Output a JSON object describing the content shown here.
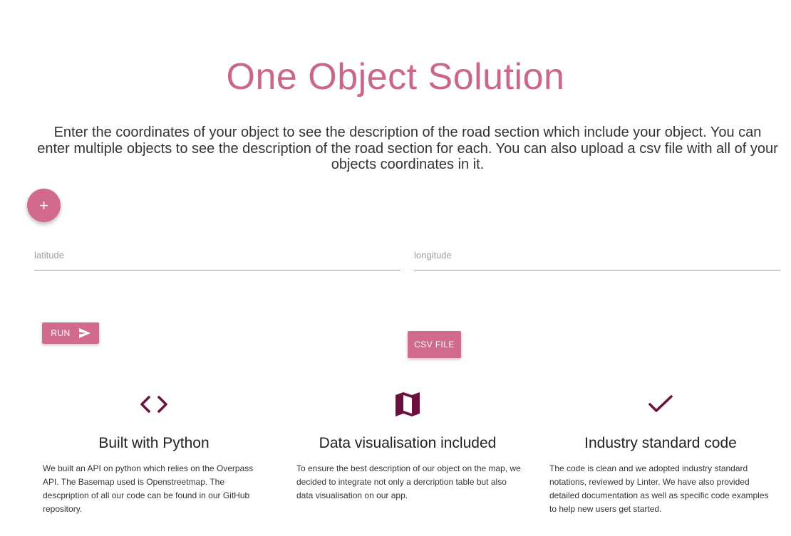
{
  "header": {
    "title": "One Object Solution",
    "intro": "Enter the coordinates of your object to see the description of the road section which include your object. You can enter multiple objects to see the description of the road section for each. You can also upload a csv file with all of your objects coordinates in it."
  },
  "form": {
    "add_label": "+",
    "latitude": {
      "placeholder": "latitude",
      "value": ""
    },
    "longitude": {
      "placeholder": "longitude",
      "value": ""
    },
    "run_label": "RUN",
    "csv_label": "CSV FILE"
  },
  "features": [
    {
      "icon": "code-icon",
      "title": "Built with Python",
      "text": "We built an API on python which relies on the Overpass API. The Basemap used is Openstreetmap. The descpription of all our code can be found in our GitHub repository."
    },
    {
      "icon": "map-icon",
      "title": "Data visualisation included",
      "text": "To ensure the best description of our object on the map, we decided to integrate not only a dercription table but also data visualisation on our app."
    },
    {
      "icon": "check-icon",
      "title": "Industry standard code",
      "text": "The code is clean and we adopted industry standard notations, reviewed by Linter. We have also provided detailed documentation as well as specific code examples to help new users get started."
    }
  ],
  "colors": {
    "accent": "#d16a8c",
    "title": "#c9668a",
    "icon": "#6b0f3e"
  }
}
